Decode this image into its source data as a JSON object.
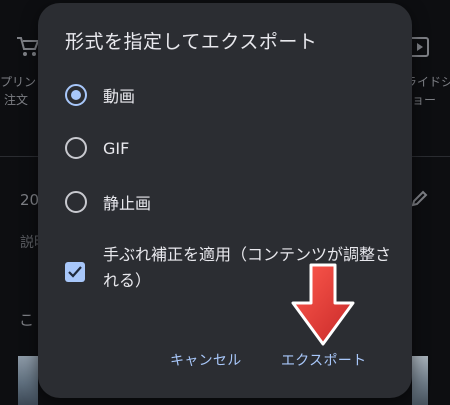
{
  "background": {
    "print_label_line1": "プリント",
    "print_label_line2": "注文",
    "slides_label_line1": "ライドシ",
    "slides_label_line2": "ョー",
    "date_text": "20",
    "description_text": "説明",
    "section_text": "こ"
  },
  "dialog": {
    "title": "形式を指定してエクスポート",
    "options": [
      {
        "label": "動画",
        "selected": true
      },
      {
        "label": "GIF",
        "selected": false
      },
      {
        "label": "静止画",
        "selected": false
      }
    ],
    "stabilize": {
      "label": "手ぶれ補正を適用（コンテンツが調整される）",
      "checked": true
    },
    "buttons": {
      "cancel": "キャンセル",
      "export": "エクスポート"
    }
  },
  "colors": {
    "accent": "#a8c7fa",
    "dialog_bg": "#2b2d32",
    "arrow": "#e53935"
  }
}
